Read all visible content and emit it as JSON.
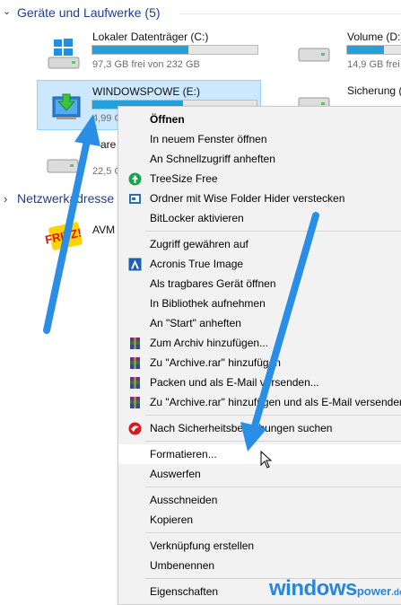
{
  "section_devices": {
    "chevron": "⌄",
    "title": "Geräte und Laufwerke (5)"
  },
  "drives": {
    "c": {
      "name": "Lokaler Datenträger (C:)",
      "free": "97,3 GB frei von 232 GB",
      "used_fraction": 0.58,
      "icon": "windows-drive-icon"
    },
    "d": {
      "name": "Volume (D:)",
      "free": "14,9 GB frei",
      "used_fraction": 0.6,
      "icon": "hard-drive-icon"
    },
    "e": {
      "name": "WINDOWSPOWE (E:)",
      "free": "4,99 G",
      "used_fraction": 0.55,
      "icon": "usb-drive-green-arrow-icon"
    },
    "backup": {
      "name": "Sicherung (",
      "icon": "hard-drive-icon"
    },
    "fourth": {
      "name": "are",
      "free": "22,5 G",
      "icon": "hard-drive-icon"
    }
  },
  "section_network": {
    "chevron": "›",
    "title": "Netzwerkadresse"
  },
  "network": {
    "avm": {
      "name": "AVM",
      "logo_text": "FRITZ!"
    }
  },
  "menu": {
    "groups": [
      [
        {
          "label": "Öffnen",
          "bold": true
        },
        {
          "label": "In neuem Fenster öffnen"
        },
        {
          "label": "An Schnellzugriff anheften"
        },
        {
          "label": "TreeSize Free",
          "icon": "treesize-icon"
        },
        {
          "label": "Ordner mit Wise Folder Hider verstecken",
          "icon": "wise-folder-hider-icon"
        },
        {
          "label": "BitLocker aktivieren"
        }
      ],
      [
        {
          "label": "Zugriff gewähren auf"
        },
        {
          "label": "Acronis True Image",
          "icon": "acronis-icon"
        },
        {
          "label": "Als tragbares Gerät öffnen"
        },
        {
          "label": "In Bibliothek aufnehmen"
        },
        {
          "label": "An \"Start\" anheften"
        },
        {
          "label": "Zum Archiv hinzufügen...",
          "icon": "winrar-icon"
        },
        {
          "label": "Zu \"Archive.rar\" hinzufügen",
          "icon": "winrar-icon"
        },
        {
          "label": "Packen und als E-Mail versenden...",
          "icon": "winrar-icon"
        },
        {
          "label": "Zu \"Archive.rar\" hinzufügen und als E-Mail versenden",
          "icon": "winrar-icon"
        }
      ],
      [
        {
          "label": "Nach Sicherheitsbedrohungen suchen",
          "icon": "trend-micro-icon"
        }
      ],
      [
        {
          "label": "Formatieren...",
          "hover": true
        },
        {
          "label": "Auswerfen"
        }
      ],
      [
        {
          "label": "Ausschneiden"
        },
        {
          "label": "Kopieren"
        }
      ],
      [
        {
          "label": "Verknüpfung erstellen"
        },
        {
          "label": "Umbenennen"
        }
      ],
      [
        {
          "label": "Eigenschaften"
        }
      ]
    ]
  },
  "watermark": {
    "brand": "windows",
    "suffix": "power",
    "tld": ".de"
  },
  "colors": {
    "accent": "#26a0da",
    "selection": "#cce8ff",
    "arrow": "#2b8ee6",
    "brand": "#2a86d9"
  }
}
